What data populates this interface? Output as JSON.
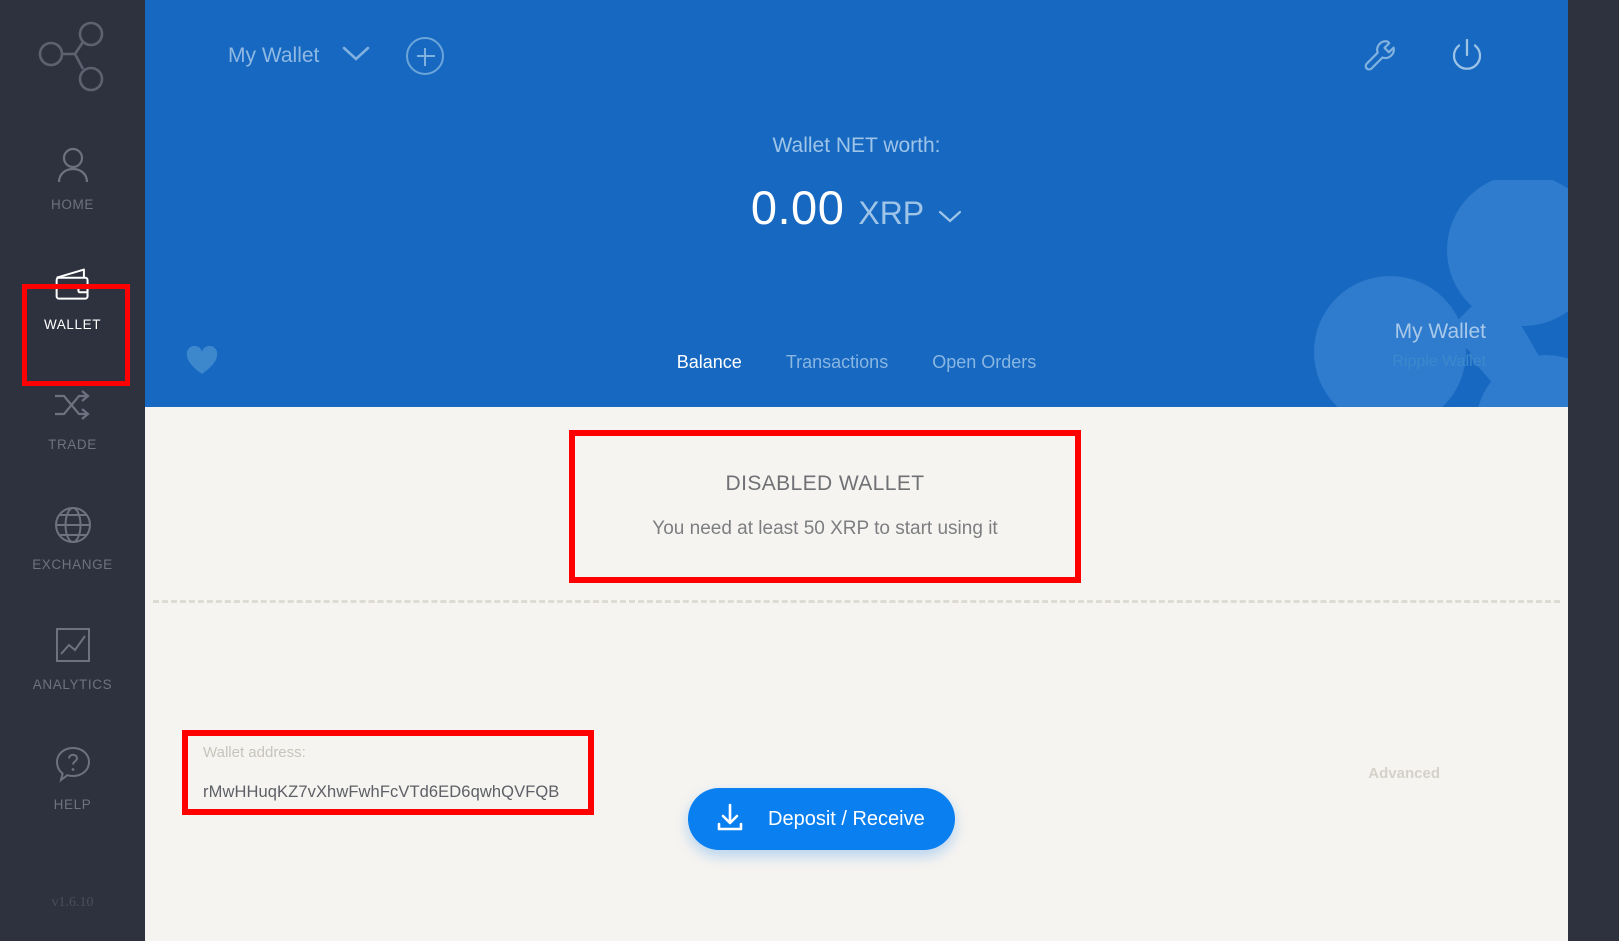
{
  "app": {
    "version": "v1.6.10",
    "accent_blue": "#1668c1",
    "button_blue": "#0a7ff0",
    "sidebar_bg": "#2e323e",
    "body_bg": "#f6f4f0",
    "highlight_red": "#ff0000"
  },
  "sidebar": {
    "logo_icon": "ripple-network-icon",
    "items": [
      {
        "label": "HOME",
        "icon": "user-icon",
        "active": false
      },
      {
        "label": "WALLET",
        "icon": "wallet-icon",
        "active": true
      },
      {
        "label": "TRADE",
        "icon": "shuffle-icon",
        "active": false
      },
      {
        "label": "EXCHANGE",
        "icon": "globe-icon",
        "active": false
      },
      {
        "label": "ANALYTICS",
        "icon": "chart-icon",
        "active": false
      },
      {
        "label": "HELP",
        "icon": "question-icon",
        "active": false
      }
    ]
  },
  "header": {
    "wallet_selector": {
      "label": "My Wallet",
      "icon": "chevron-down-icon"
    },
    "add_wallet_icon": "plus-circle-icon",
    "settings_icon": "wrench-icon",
    "power_icon": "power-icon",
    "networth": {
      "caption": "Wallet NET worth:",
      "value": "0.00",
      "currency": "XRP",
      "currency_icon": "chevron-down-icon"
    },
    "favorite_icon": "heart-icon",
    "tabs": [
      {
        "label": "Balance",
        "active": true
      },
      {
        "label": "Transactions",
        "active": false
      },
      {
        "label": "Open Orders",
        "active": false
      }
    ],
    "identity": {
      "name": "My Wallet",
      "type": "Ripple Wallet",
      "watermark_icon": "ripple-logo-icon"
    }
  },
  "main": {
    "disabled_notice": {
      "title": "DISABLED WALLET",
      "subtitle": "You need at least 50 XRP to start using it"
    },
    "address": {
      "label": "Wallet address:",
      "value": "rMwHHuqKZ7vXhwFwhFcVTd6ED6qwhQVFQB"
    },
    "deposit_button": {
      "label": "Deposit / Receive",
      "icon": "download-tray-icon"
    },
    "advanced_link": "Advanced"
  }
}
